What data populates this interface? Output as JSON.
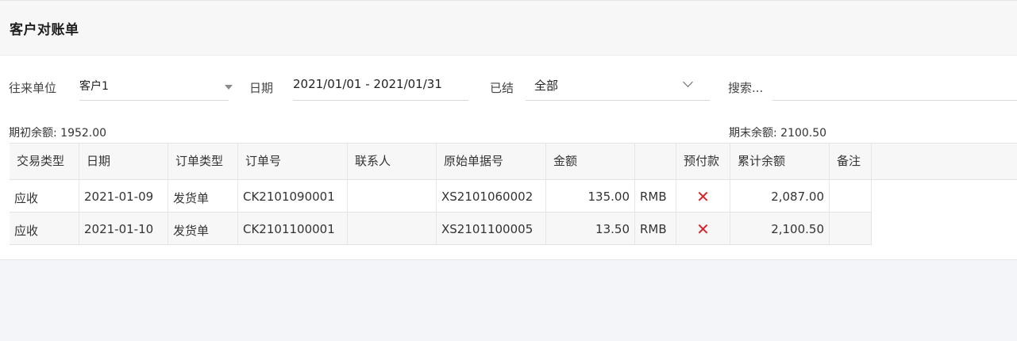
{
  "page": {
    "title": "客户对账单"
  },
  "filters": {
    "partner_label": "往来单位",
    "partner_value": "客户1",
    "date_label": "日期",
    "date_value": "2021/01/01 - 2021/01/31",
    "settled_label": "已结",
    "settled_value": "全部",
    "search_placeholder": "搜索..."
  },
  "balances": {
    "opening": "期初余额: 1952.00",
    "closing": "期末余额: 2100.50"
  },
  "table": {
    "columns": [
      "交易类型",
      "日期",
      "订单类型",
      "订单号",
      "联系人",
      "原始单据号",
      "金额",
      "",
      "预付款",
      "累计余额",
      "备注"
    ],
    "rows": [
      {
        "type": "应收",
        "date": "2021-01-09",
        "order_type": "发货单",
        "order_no": "CK2101090001",
        "contact": "",
        "source_no": "XS2101060002",
        "amount": "135.00",
        "currency": "RMB",
        "prepaid": "✕",
        "balance": "2,087.00",
        "remark": ""
      },
      {
        "type": "应收",
        "date": "2021-01-10",
        "order_type": "发货单",
        "order_no": "CK2101100001",
        "contact": "",
        "source_no": "XS2101100005",
        "amount": "13.50",
        "currency": "RMB",
        "prepaid": "✕",
        "balance": "2,100.50",
        "remark": ""
      }
    ]
  },
  "colors": {
    "prepaid_false": "#d6232b"
  },
  "icons": {
    "partner_dropdown": "caret-down-icon",
    "settled_dropdown": "chevron-down-icon",
    "prepaid_false": "close-icon"
  }
}
